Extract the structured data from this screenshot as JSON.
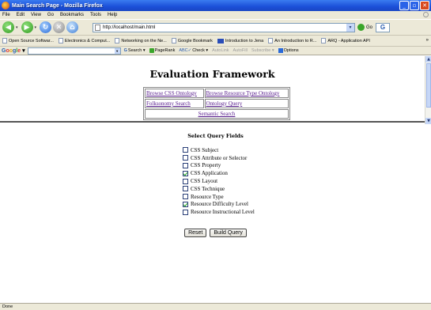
{
  "window": {
    "title": "Main Search Page - Mozilla Firefox"
  },
  "menubar": {
    "items": [
      "File",
      "Edit",
      "View",
      "Go",
      "Bookmarks",
      "Tools",
      "Help"
    ]
  },
  "navbar": {
    "url": "http://localhost/main.html",
    "go_label": "Go"
  },
  "bookmarks": {
    "items": [
      "Open Source Softwar...",
      "Electronics & Comput...",
      "Networking on the Ne...",
      "Google Bookmark",
      "Introduction to Jena",
      "An Introduction to R...",
      "ARQ - Application API"
    ],
    "more": "»"
  },
  "google_toolbar": {
    "label": "Google",
    "search": "Search",
    "pagerank": "PageRank",
    "check": "Check",
    "autolink": "AutoLink",
    "autofill": "AutoFill",
    "subscribe": "Subscribe",
    "options": "Options"
  },
  "page": {
    "title": "Evaluation Framework",
    "nav_links": {
      "browse_css": "Browse CSS Ontology",
      "browse_resource": "Browse Resource Type Ontology",
      "folksonomy": "Folksonomy Search",
      "ontology_query": "Ontology Query",
      "semantic": "Semantic Search"
    },
    "query_title": "Select Query Fields",
    "fields": [
      {
        "label": "CSS Subject",
        "checked": false
      },
      {
        "label": "CSS Attribute or Selector",
        "checked": false
      },
      {
        "label": "CSS Property",
        "checked": false
      },
      {
        "label": "CSS Application",
        "checked": true
      },
      {
        "label": "CSS Layout",
        "checked": false
      },
      {
        "label": "CSS Technique",
        "checked": false
      },
      {
        "label": "Resource Type",
        "checked": false
      },
      {
        "label": "Resource Difficulty Level",
        "checked": true
      },
      {
        "label": "Resource Instructional Level",
        "checked": false
      }
    ],
    "reset_label": "Reset",
    "build_label": "Build Query"
  },
  "status": {
    "text": "Done"
  }
}
